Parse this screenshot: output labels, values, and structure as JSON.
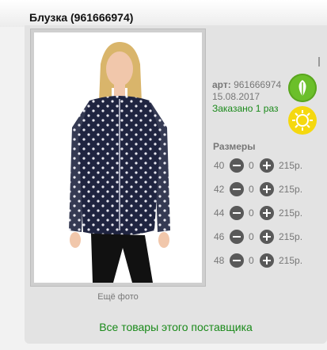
{
  "product": {
    "title": "Блузка (961666974)",
    "article_label": "арт:",
    "article": "961666974",
    "date": "15.08.2017",
    "ordered": "Заказано 1 раз",
    "more_photos": "Ещё фото",
    "sizes_title": "Размеры",
    "supplier_link": "Все товары этого поставщика",
    "colors": {
      "leaf": "#6bbf2a",
      "sun": "#f5d80f",
      "link": "#1a8a1a"
    }
  },
  "sizes": [
    {
      "size": "40",
      "qty": "0",
      "price": "215р."
    },
    {
      "size": "42",
      "qty": "0",
      "price": "215р."
    },
    {
      "size": "44",
      "qty": "0",
      "price": "215р."
    },
    {
      "size": "46",
      "qty": "0",
      "price": "215р."
    },
    {
      "size": "48",
      "qty": "0",
      "price": "215р."
    }
  ]
}
